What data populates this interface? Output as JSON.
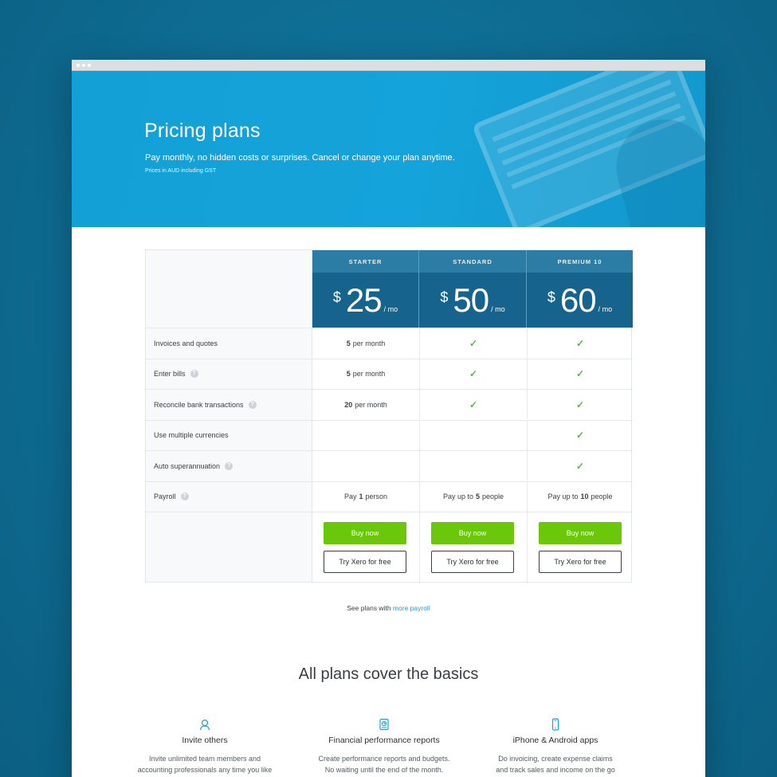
{
  "hero": {
    "title": "Pricing plans",
    "subtitle": "Pay monthly, no hidden costs or surprises. Cancel or change your plan anytime.",
    "note": "Prices in AUD including GST"
  },
  "plans": [
    {
      "name": "STARTER",
      "currency": "$",
      "amount": "25",
      "period": "/ mo"
    },
    {
      "name": "STANDARD",
      "currency": "$",
      "amount": "50",
      "period": "/ mo"
    },
    {
      "name": "PREMIUM 10",
      "currency": "$",
      "amount": "60",
      "period": "/ mo"
    }
  ],
  "features": [
    {
      "label": "Invoices and quotes",
      "info": false,
      "starter": {
        "bold": "5",
        "text": "per month"
      },
      "standard": "check",
      "premium": "check"
    },
    {
      "label": "Enter bills",
      "info": true,
      "starter": {
        "bold": "5",
        "text": "per month"
      },
      "standard": "check",
      "premium": "check"
    },
    {
      "label": "Reconcile bank transactions",
      "info": true,
      "starter": {
        "bold": "20",
        "text": "per month"
      },
      "standard": "check",
      "premium": "check"
    },
    {
      "label": "Use multiple currencies",
      "info": false,
      "starter": "",
      "standard": "",
      "premium": "check"
    },
    {
      "label": "Auto superannuation",
      "info": true,
      "starter": "",
      "standard": "",
      "premium": "check"
    },
    {
      "label": "Payroll",
      "info": true,
      "starter": {
        "pre": "Pay",
        "bold": "1",
        "text": "person"
      },
      "standard": {
        "pre": "Pay up to",
        "bold": "5",
        "text": "people"
      },
      "premium": {
        "pre": "Pay up to",
        "bold": "10",
        "text": "people"
      }
    }
  ],
  "buttons": {
    "buy": "Buy now",
    "try": "Try Xero for free"
  },
  "more": {
    "prefix": "See plans with",
    "link": "more payroll"
  },
  "basics": {
    "title": "All plans cover the basics",
    "items": [
      {
        "icon": "person-icon",
        "name": "Invite others",
        "line1": "Invite unlimited team members and",
        "line2": "accounting professionals any time you like"
      },
      {
        "icon": "report-icon",
        "name": "Financial performance reports",
        "line1": "Create performance reports and budgets.",
        "line2": "No waiting until the end of the month."
      },
      {
        "icon": "phone-icon",
        "name": "iPhone & Android apps",
        "line1": "Do invoicing, create expense claims",
        "line2": "and track sales and income on the go"
      }
    ]
  },
  "colors": {
    "background": "#0e6a90",
    "hero": "#14a3da",
    "plan_header": "#2b7da6",
    "plan_price": "#16648d",
    "buy_button": "#6bc70a",
    "check": "#56b948",
    "link": "#1aa1d9"
  }
}
